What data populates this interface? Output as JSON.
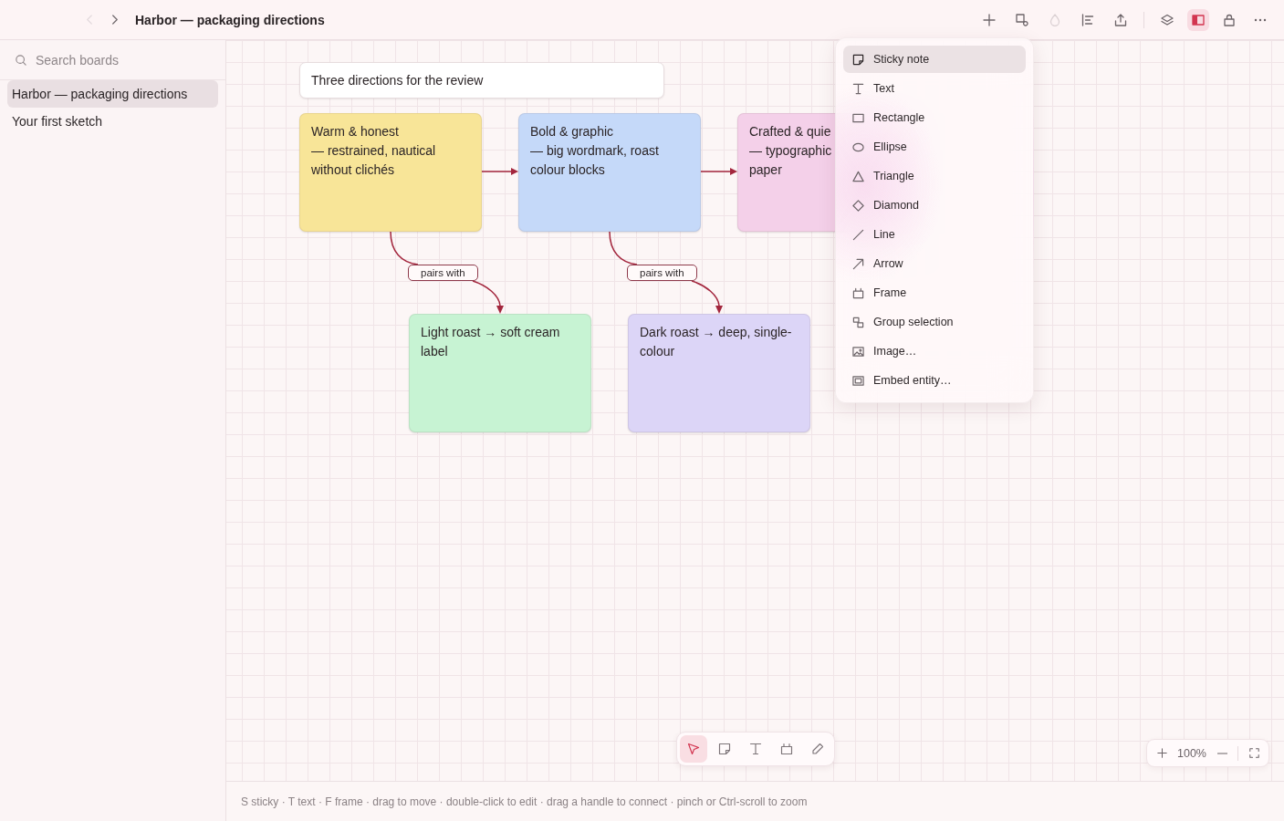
{
  "topbar": {
    "nav": [
      {
        "kind": "back",
        "disabled": true
      },
      {
        "kind": "forward",
        "disabled": false
      }
    ],
    "title": "Harbor — packaging directions",
    "tool_groups": [
      {
        "tools": [
          {
            "kind": "add",
            "disabled": false,
            "on": false
          },
          {
            "kind": "shapes",
            "disabled": false,
            "on": false
          },
          {
            "kind": "color",
            "disabled": true,
            "on": false
          },
          {
            "kind": "align",
            "disabled": false,
            "on": false
          },
          {
            "kind": "export",
            "disabled": false,
            "on": false
          }
        ]
      },
      {
        "tools": [
          {
            "kind": "layers",
            "disabled": false,
            "on": false
          },
          {
            "kind": "sidebar",
            "disabled": false,
            "on": true
          },
          {
            "kind": "lock",
            "disabled": false,
            "on": false
          },
          {
            "kind": "more",
            "disabled": false,
            "on": false
          }
        ]
      }
    ]
  },
  "sidebar": {
    "search": {
      "placeholder": "Search boards"
    },
    "boards": [
      {
        "label": "Harbor — packaging directions",
        "selected": true
      },
      {
        "label": "Your first sketch",
        "selected": false
      }
    ]
  },
  "canvas": {
    "notes": [
      {
        "kind": "text",
        "lines": [
          "Three directions for the review"
        ]
      },
      {
        "kind": "sticky",
        "color": "#f8e598",
        "lines": [
          "Warm & honest",
          "— restrained, nautical",
          "without clichés"
        ]
      },
      {
        "kind": "sticky",
        "color": "#c5d9f9",
        "lines": [
          "Bold & graphic",
          "— big wordmark, roast",
          "colour blocks"
        ]
      },
      {
        "kind": "sticky",
        "color": "#f4d0e9",
        "lines": [
          "Crafted & quie",
          "— typographic",
          "paper"
        ]
      },
      {
        "kind": "sticky",
        "color": "#c7f3d3",
        "lines": [
          "Light roast → soft cream",
          "label"
        ]
      },
      {
        "kind": "sticky",
        "color": "#dcd5f7",
        "lines": [
          "Dark roast → deep, single-",
          "colour"
        ]
      }
    ],
    "edges": [
      {
        "kind": "straight"
      },
      {
        "kind": "straight"
      },
      {
        "kind": "curved",
        "label": "pairs with"
      },
      {
        "kind": "curved",
        "label": "pairs with"
      }
    ]
  },
  "insert_menu": {
    "items": [
      {
        "kind": "sticky",
        "label": "Sticky note",
        "selected": true
      },
      {
        "kind": "text",
        "label": "Text",
        "selected": false
      },
      {
        "kind": "rectangle",
        "label": "Rectangle",
        "selected": false
      },
      {
        "kind": "ellipse",
        "label": "Ellipse",
        "selected": false
      },
      {
        "kind": "triangle",
        "label": "Triangle",
        "selected": false
      },
      {
        "kind": "diamond",
        "label": "Diamond",
        "selected": false
      },
      {
        "kind": "line",
        "label": "Line",
        "selected": false
      },
      {
        "kind": "arrow",
        "label": "Arrow",
        "selected": false
      },
      {
        "kind": "frame",
        "label": "Frame",
        "selected": false
      },
      {
        "kind": "group",
        "label": "Group selection",
        "selected": false
      },
      {
        "kind": "image",
        "label": "Image…",
        "selected": false
      },
      {
        "kind": "embed",
        "label": "Embed entity…",
        "selected": false
      }
    ]
  },
  "toolbar": {
    "tools": [
      {
        "kind": "select",
        "selected": true
      },
      {
        "kind": "sticky",
        "selected": false
      },
      {
        "kind": "text",
        "selected": false
      },
      {
        "kind": "frame",
        "selected": false
      },
      {
        "kind": "pen",
        "selected": false
      }
    ]
  },
  "zoom": {
    "value": "100%"
  },
  "status_bar": {
    "hint": "S sticky · T text · F frame · drag to move · double-click to edit · drag a handle to connect · pinch or Ctrl-scroll to zoom"
  }
}
